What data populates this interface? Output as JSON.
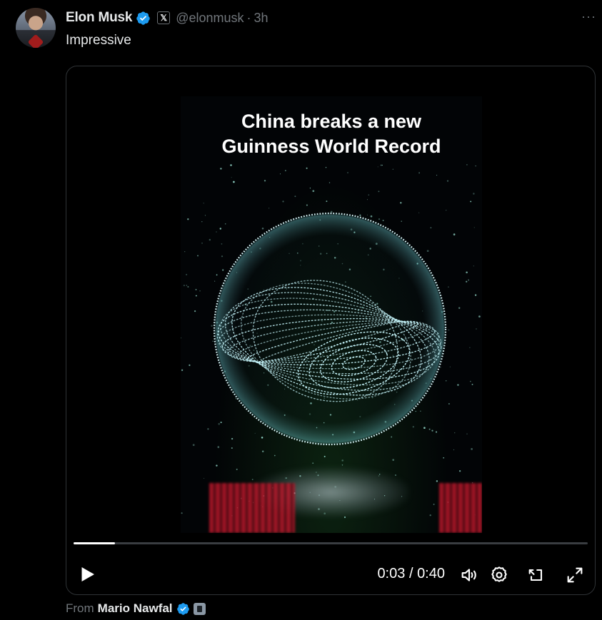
{
  "post": {
    "author_name": "Elon Musk",
    "handle": "@elonmusk",
    "dot": "·",
    "time": "3h",
    "x_badge": "𝕏",
    "more": "···",
    "text": "Impressive"
  },
  "video": {
    "caption_line1": "China breaks a new",
    "caption_line2": "Guinness World Record",
    "current_time": "0:03",
    "separator": "/",
    "duration": "0:40",
    "progress_fraction": 0.08
  },
  "attribution": {
    "prefix": "From",
    "source_name": "Mario Nawfal"
  },
  "colors": {
    "verified_blue": "#1d9bf0",
    "text_primary": "#e7e9ea",
    "text_secondary": "#71767b",
    "sphere_cyan": "#bff6ff"
  },
  "icons": {
    "verified": "verified-badge-icon",
    "more": "more-icon",
    "play": "play-icon",
    "volume": "volume-icon",
    "settings": "gear-icon",
    "pip": "picture-in-picture-icon",
    "fullscreen": "fullscreen-icon",
    "affiliate": "affiliate-badge-icon"
  }
}
